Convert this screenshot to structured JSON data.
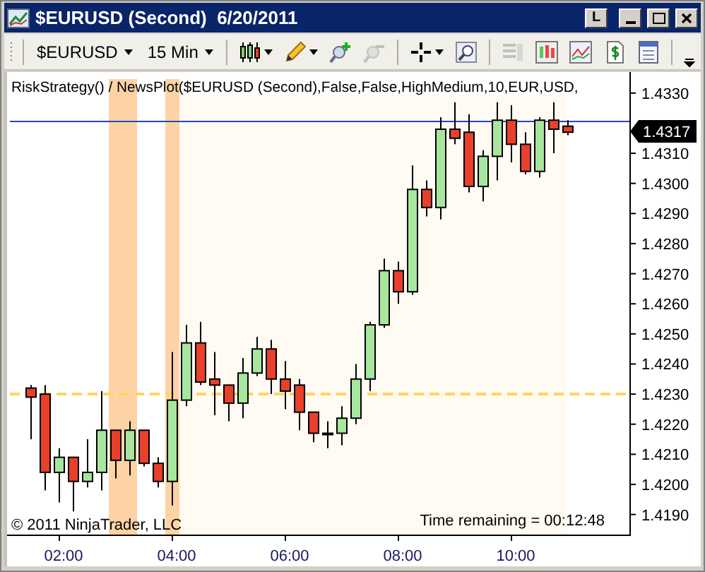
{
  "window": {
    "title": "$EURUSD (Second)  6/20/2011",
    "controls": [
      {
        "kind": "link",
        "label": "L"
      },
      {
        "kind": "minimize"
      },
      {
        "kind": "maximize"
      },
      {
        "kind": "close"
      }
    ]
  },
  "toolbar": {
    "instrument": "$EURUSD",
    "interval": "15 Min",
    "tools": [
      {
        "kind": "chart-style",
        "menu": true,
        "disabled": false
      },
      {
        "kind": "drawing-tool",
        "menu": true,
        "disabled": false
      },
      {
        "kind": "zoom-in",
        "menu": false,
        "disabled": false
      },
      {
        "kind": "zoom-out",
        "menu": false,
        "disabled": true
      },
      {
        "kind": "crosshair",
        "menu": true,
        "disabled": false
      },
      {
        "kind": "zoom",
        "menu": false,
        "disabled": false
      },
      {
        "kind": "data-box",
        "menu": false,
        "disabled": true
      },
      {
        "kind": "bars",
        "menu": false,
        "disabled": false
      },
      {
        "kind": "indicators",
        "menu": false,
        "disabled": false
      },
      {
        "kind": "strategies",
        "menu": false,
        "disabled": false
      },
      {
        "kind": "properties",
        "menu": false,
        "disabled": false
      }
    ]
  },
  "chart": {
    "legend": "RiskStrategy() / NewsPlot($EURUSD (Second),False,False,HighMedium,10,EUR,USD,",
    "copyright": "© 2011 NinjaTrader, LLC",
    "time_remaining": "Time remaining = 00:12:48",
    "price_marker": "1.4317",
    "chart_data": {
      "type": "candlestick",
      "ylim": [
        1.41831,
        1.4337
      ],
      "categories": [
        null,
        null,
        "02:00",
        null,
        null,
        null,
        null,
        null,
        null,
        null,
        "04:00",
        null,
        null,
        null,
        null,
        null,
        null,
        null,
        "06:00",
        null,
        null,
        null,
        null,
        null,
        null,
        null,
        "08:00",
        null,
        null,
        null,
        null,
        null,
        null,
        null,
        "10:00",
        null,
        null,
        null,
        null
      ],
      "yticks": [
        {
          "value": 1.419,
          "label": "1.4190"
        },
        {
          "value": 1.42,
          "label": "1.4200"
        },
        {
          "value": 1.421,
          "label": "1.4210"
        },
        {
          "value": 1.422,
          "label": "1.4220"
        },
        {
          "value": 1.423,
          "label": "1.4230"
        },
        {
          "value": 1.424,
          "label": "1.4240"
        },
        {
          "value": 1.425,
          "label": "1.4250"
        },
        {
          "value": 1.426,
          "label": "1.4260"
        },
        {
          "value": 1.427,
          "label": "1.4270"
        },
        {
          "value": 1.428,
          "label": "1.4280"
        },
        {
          "value": 1.429,
          "label": "1.4290"
        },
        {
          "value": 1.43,
          "label": "1.4300"
        },
        {
          "value": 1.431,
          "label": "1.4310"
        },
        {
          "value": 1.433,
          "label": "1.4330"
        }
      ],
      "ohlc": [
        [
          1.4232,
          1.4233,
          1.4215,
          1.4229
        ],
        [
          1.423,
          1.4233,
          1.4198,
          1.4204
        ],
        [
          1.4204,
          1.4212,
          1.4194,
          1.4209
        ],
        [
          1.4209,
          1.4209,
          1.4191,
          1.4201
        ],
        [
          1.4201,
          1.4215,
          1.4199,
          1.4204
        ],
        [
          1.4204,
          1.4231,
          1.4198,
          1.4218
        ],
        [
          1.4218,
          1.4218,
          1.4202,
          1.4208
        ],
        [
          1.4208,
          1.4221,
          1.4203,
          1.4218
        ],
        [
          1.4218,
          1.4218,
          1.4206,
          1.4207
        ],
        [
          1.4207,
          1.4209,
          1.4199,
          1.4201
        ],
        [
          1.4201,
          1.4244,
          1.4193,
          1.4228
        ],
        [
          1.4228,
          1.4253,
          1.4226,
          1.4247
        ],
        [
          1.4247,
          1.4254,
          1.4233,
          1.4234
        ],
        [
          1.4235,
          1.4244,
          1.4223,
          1.4233
        ],
        [
          1.4233,
          1.4233,
          1.4221,
          1.4227
        ],
        [
          1.4227,
          1.4242,
          1.4222,
          1.4237
        ],
        [
          1.4237,
          1.4249,
          1.4236,
          1.4245
        ],
        [
          1.4245,
          1.4248,
          1.423,
          1.4235
        ],
        [
          1.4235,
          1.4241,
          1.4225,
          1.4231
        ],
        [
          1.4233,
          1.4235,
          1.4218,
          1.4224
        ],
        [
          1.4224,
          1.4224,
          1.4214,
          1.4217
        ],
        [
          1.4217,
          1.4221,
          1.4212,
          1.4217
        ],
        [
          1.4217,
          1.4226,
          1.4213,
          1.4222
        ],
        [
          1.4222,
          1.424,
          1.422,
          1.4235
        ],
        [
          1.4235,
          1.4254,
          1.4231,
          1.4253
        ],
        [
          1.4253,
          1.4275,
          1.4252,
          1.4271
        ],
        [
          1.4271,
          1.4274,
          1.426,
          1.4264
        ],
        [
          1.4264,
          1.4306,
          1.4263,
          1.4298
        ],
        [
          1.4298,
          1.4301,
          1.4289,
          1.4292
        ],
        [
          1.4292,
          1.4322,
          1.4288,
          1.4318
        ],
        [
          1.4318,
          1.4327,
          1.4313,
          1.4315
        ],
        [
          1.4317,
          1.4323,
          1.4297,
          1.4299
        ],
        [
          1.4299,
          1.4311,
          1.4294,
          1.4309
        ],
        [
          1.4309,
          1.4327,
          1.4301,
          1.4321
        ],
        [
          1.4321,
          1.4326,
          1.4307,
          1.4313
        ],
        [
          1.4313,
          1.4317,
          1.4303,
          1.4304
        ],
        [
          1.4304,
          1.4322,
          1.4302,
          1.4321
        ],
        [
          1.4321,
          1.4327,
          1.431,
          1.4318
        ],
        [
          1.4319,
          1.4321,
          1.4316,
          1.4317
        ]
      ],
      "data_labels": true
    }
  }
}
